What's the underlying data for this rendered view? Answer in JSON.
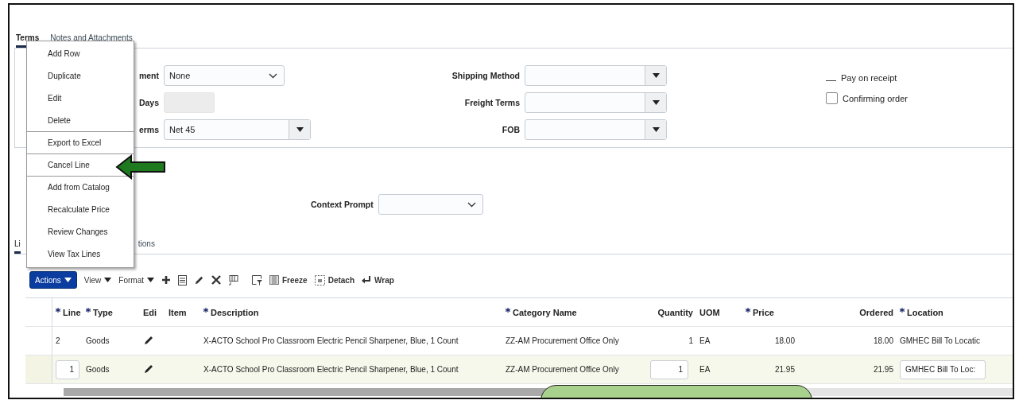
{
  "tabs": [
    {
      "label": "Terms",
      "selected": true
    },
    {
      "label": "Notes and Attachments",
      "selected": false
    }
  ],
  "terms": {
    "column_1": [
      {
        "label": "ment",
        "kind": "chevron",
        "value": "None"
      },
      {
        "label": "Days",
        "kind": "disabled"
      },
      {
        "label": "erms",
        "kind": "button",
        "value": "Net 45"
      }
    ],
    "column_2": [
      {
        "label": "Shipping Method",
        "kind": "button"
      },
      {
        "label": "Freight Terms",
        "kind": "button"
      },
      {
        "label": "FOB",
        "kind": "button"
      }
    ],
    "options": [
      {
        "label": "Pay on receipt",
        "kind": "dash"
      },
      {
        "label": "Confirming order",
        "kind": "checkbox",
        "checked": false
      }
    ]
  },
  "context_prompt": {
    "label": "Context Prompt"
  },
  "lines_tabs": [
    {
      "label": "Li",
      "selected": true
    },
    {
      "label": "tions",
      "selected": false
    }
  ],
  "actions_menu": [
    {
      "label": "Add Row",
      "divider_after": false
    },
    {
      "label": "Duplicate",
      "divider_after": false
    },
    {
      "label": "Edit",
      "divider_after": false
    },
    {
      "label": "Delete",
      "divider_after": true
    },
    {
      "label": "Export to Excel",
      "divider_after": true
    },
    {
      "label": "Cancel Line",
      "divider_after": true
    },
    {
      "label": "Add from Catalog",
      "divider_after": false
    },
    {
      "label": "Recalculate Price",
      "divider_after": false
    },
    {
      "label": "Review Changes",
      "divider_after": false
    },
    {
      "label": "View Tax Lines",
      "divider_after": false
    }
  ],
  "toolbar": {
    "actions": "Actions",
    "view": "View",
    "format": "Format",
    "freeze": "Freeze",
    "detach": "Detach",
    "wrap": "Wrap"
  },
  "table": {
    "columns": [
      {
        "label": "Line",
        "required": true
      },
      {
        "label": "Type",
        "required": true
      },
      {
        "label": "Edi",
        "required": false
      },
      {
        "label": "Item",
        "required": false
      },
      {
        "label": "Description",
        "required": true
      },
      {
        "label": "Category Name",
        "required": true
      },
      {
        "label": "Quantity",
        "required": false
      },
      {
        "label": "UOM",
        "required": false
      },
      {
        "label": "Price",
        "required": true
      },
      {
        "label": "Ordered",
        "required": false
      },
      {
        "label": "Location",
        "required": true
      }
    ],
    "rows": [
      {
        "selected": false,
        "line": "2",
        "type": "Goods",
        "description": "X-ACTO School Pro Classroom Electric Pencil Sharpener, Blue, 1 Count",
        "category": "ZZ-AM Procurement Office Only",
        "quantity": "1",
        "uom": "EA",
        "price": "18.00",
        "ordered": "18.00",
        "location": "GMHEC Bill To Locatic"
      },
      {
        "selected": true,
        "line": "1",
        "type": "Goods",
        "description": "X-ACTO School Pro Classroom Electric Pencil Sharpener, Blue, 1 Count",
        "category": "ZZ-AM Procurement Office Only",
        "quantity": "1",
        "uom": "EA",
        "price": "21.95",
        "ordered": "21.95",
        "location": "GMHEC Bill To Loc:"
      }
    ]
  }
}
